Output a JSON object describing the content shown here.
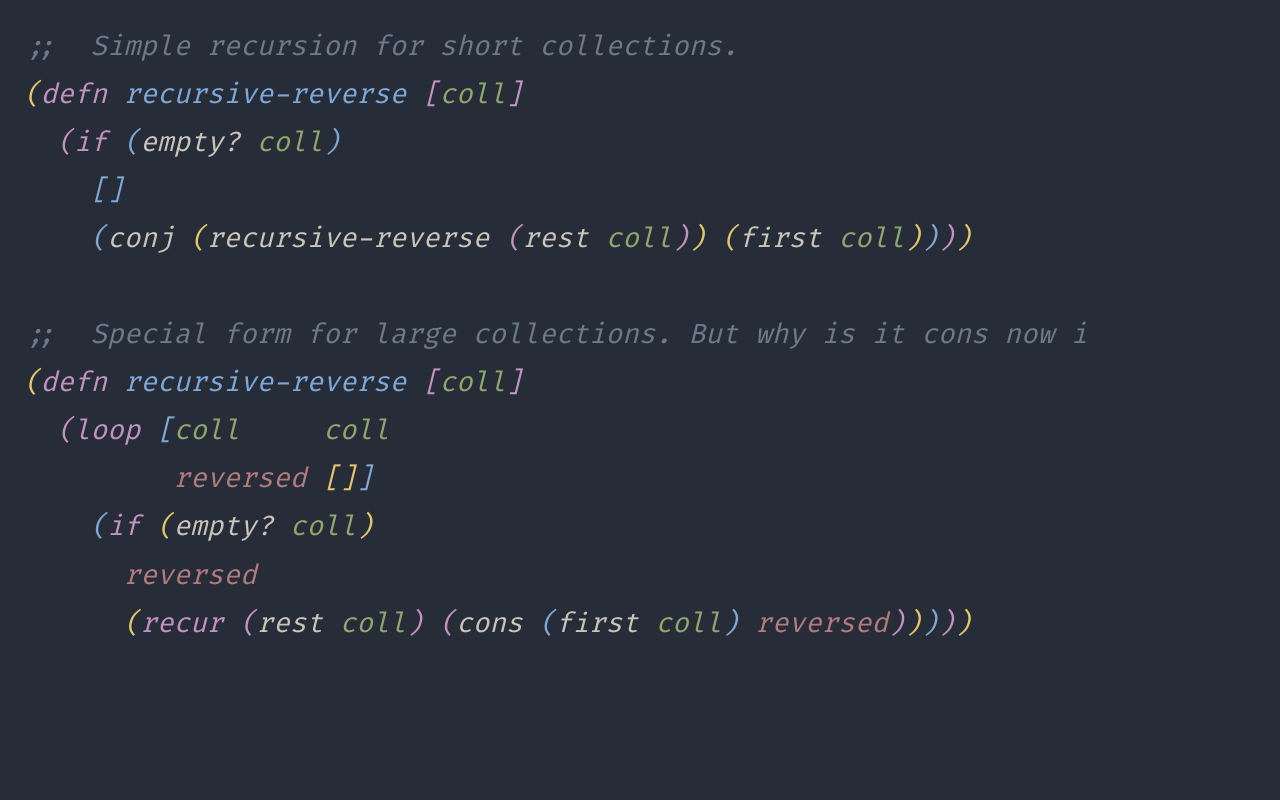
{
  "code": {
    "l1": ";;  Simple recursion for short collections.",
    "defn": "defn",
    "fname": "recursive-reverse",
    "arg": "coll",
    "if": "if",
    "empty": "empty?",
    "conj": "conj",
    "rest": "rest",
    "first": "first",
    "l9": ";;  Special form for large collections. But why is it cons now i",
    "loop": "loop",
    "reversed": "reversed",
    "recur": "recur",
    "cons": "cons",
    "emptyvec": "[]",
    "lbracket": "[",
    "rbracket": "]",
    "lp_y": "(",
    "rp_y": ")",
    "lp_p": "(",
    "rp_p": ")",
    "lp_b": "(",
    "rp_b": ")",
    "lp_g": "(",
    "rp_g": ")",
    "sp": " "
  }
}
